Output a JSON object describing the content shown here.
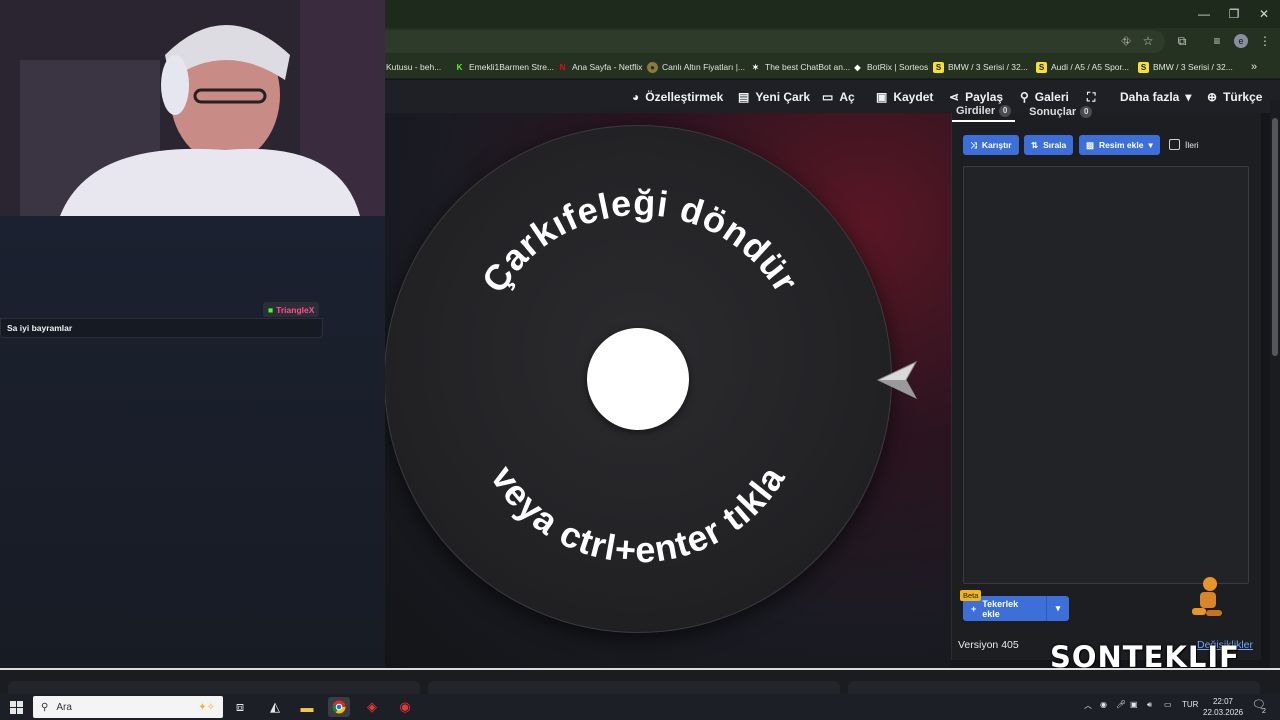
{
  "browser": {
    "bookmarks": [
      {
        "label": "Kutusu - beh...",
        "icon": "folder-icon",
        "fav": ""
      },
      {
        "label": "Emekli1Barmen Stre...",
        "icon": "kick-icon",
        "fav": "K"
      },
      {
        "label": "Ana Sayfa - Netflix",
        "icon": "netflix-icon",
        "fav": "N"
      },
      {
        "label": "Canlı Altın Fiyatları |...",
        "icon": "gold-icon",
        "fav": "●"
      },
      {
        "label": "The best ChatBot an...",
        "icon": "chatbot-icon",
        "fav": "✶"
      },
      {
        "label": "BotRix | Sorteos",
        "icon": "botrix-icon",
        "fav": "◆"
      },
      {
        "label": "BMW / 3 Serisi / 32...",
        "icon": "sahibinden-icon",
        "fav": "S"
      },
      {
        "label": "Audi / A5 / A5 Spor...",
        "icon": "sahibinden-icon",
        "fav": "S"
      },
      {
        "label": "BMW / 3 Serisi / 32...",
        "icon": "sahibinden-icon",
        "fav": "S"
      }
    ],
    "more_bookmarks": "»",
    "profile_initial": "e"
  },
  "nav": {
    "customize": "Özelleştirmek",
    "new_wheel": "Yeni Çark",
    "open": "Aç",
    "save": "Kaydet",
    "share": "Paylaş",
    "gallery": "Galeri",
    "more": "Daha fazla",
    "language": "Türkçe"
  },
  "wheel": {
    "top_text": "Çarkıfeleği döndür",
    "bottom_text": "veya ctrl+enter tıkla"
  },
  "stream": {
    "chat_user": "TriangleX",
    "chat_message": "Sa iyi bayramlar",
    "overlay_brand": "SONTEKLIF"
  },
  "panel": {
    "tabs": [
      {
        "label": "Girdiler",
        "count": "0"
      },
      {
        "label": "Sonuçlar",
        "count": "0"
      }
    ],
    "shuffle": "Karıştır",
    "sort": "Sırala",
    "add_image": "Resim ekle",
    "advanced": "İleri",
    "beta": "Beta",
    "add_wheel": "Tekerlek ekle",
    "version": "Versiyon 405",
    "changes": "Değişiklikler"
  },
  "taskbar": {
    "search_placeholder": "Ara",
    "lang": "TUR",
    "time": "22:07",
    "date": "22.03.2026",
    "notifications": "2"
  },
  "colors": {
    "accent_blue": "#3d6fd8",
    "kick_green": "#53fc18",
    "chat_name": "#ff4f8b",
    "beta_yellow": "#f2b51c"
  }
}
